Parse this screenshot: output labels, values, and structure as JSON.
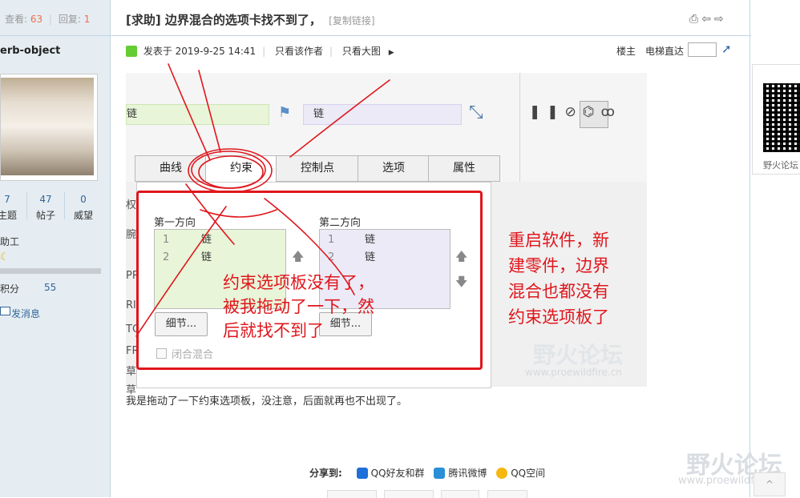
{
  "sidebar": {
    "views_label": "查看:",
    "views": "63",
    "replies_label": "回复:",
    "replies": "1",
    "username": "erb-object",
    "stats": [
      {
        "n": "7",
        "l": "主题"
      },
      {
        "n": "47",
        "l": "帖子"
      },
      {
        "n": "0",
        "l": "威望"
      }
    ],
    "group": "助工",
    "credit_label": "积分",
    "credit_value": "55",
    "send_message": "发消息",
    "icons": {
      "moon": "moon-icon",
      "mail": "mail-icon"
    }
  },
  "header": {
    "title": "[求助] 边界混合的选项卡找不到了，",
    "copy_link": "[复制链接]",
    "icons": [
      "print-icon",
      "prev-icon",
      "next-icon"
    ]
  },
  "meta": {
    "posted": "发表于 2019-9-25 14:41",
    "only_author": "只看该作者",
    "only_big": "只看大图",
    "floor": "楼主",
    "elevator": "电梯直达"
  },
  "screenshot": {
    "field1": "链",
    "field2": "链",
    "tabs": [
      "曲线",
      "约束",
      "控制点",
      "选项",
      "属性"
    ],
    "dir1": "第一方向",
    "dir2": "第二方向",
    "list1": [
      {
        "num": "1",
        "txt": "链"
      },
      {
        "num": "2",
        "txt": "链"
      }
    ],
    "list2": [
      {
        "num": "1",
        "txt": "链"
      },
      {
        "num": "2",
        "txt": "链"
      }
    ],
    "detail1": "细节...",
    "detail2": "细节...",
    "closed_blend": "闭合混合",
    "left_ghost": [
      "权",
      "腕",
      "PR",
      "RI",
      "TO",
      "FR",
      "草",
      "草"
    ],
    "annotation1": "约束选项板没有了，被我拖动了一下，然后就找不到了",
    "annotation2": "重启软件，新建零件，边界混合也都没有约束选项板了"
  },
  "caption": "我是拖动了一下约束选项板，没注意，后面就再也不出现了。",
  "share": {
    "label": "分享到:",
    "items": [
      "QQ好友和群",
      "腾讯微博",
      "QQ空间"
    ]
  },
  "right": {
    "qr_label": "野火论坛",
    "watermark": "野火论坛",
    "watermark_url": "www.proewildfire.cn"
  },
  "colors": {
    "annotation": "#e0161c",
    "link": "#336699",
    "accent": "#f26c4f"
  }
}
